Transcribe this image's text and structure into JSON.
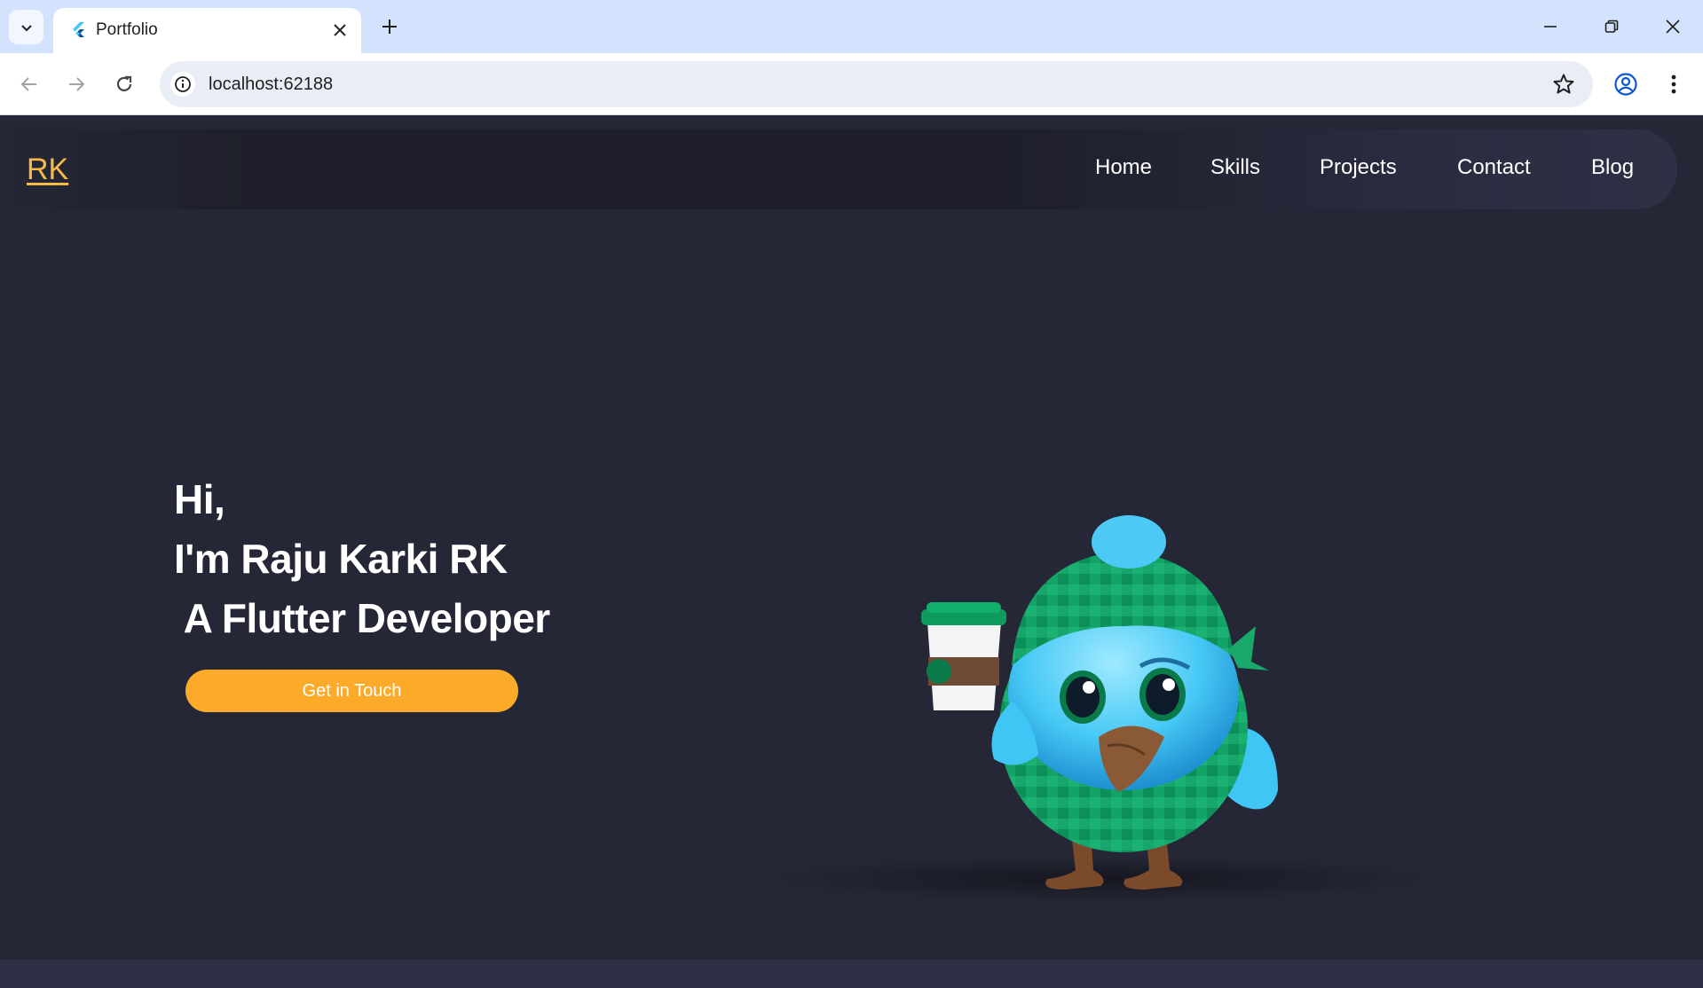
{
  "browser": {
    "tab": {
      "title": "Portfolio"
    },
    "address": {
      "url": "localhost:62188"
    }
  },
  "site": {
    "logo": "RK",
    "nav": [
      {
        "label": "Home"
      },
      {
        "label": "Skills"
      },
      {
        "label": "Projects"
      },
      {
        "label": "Contact"
      },
      {
        "label": "Blog"
      }
    ],
    "hero": {
      "line1": "Hi,",
      "line2": "I'm Raju Karki RK",
      "line3": " A Flutter Developer",
      "cta": "Get in Touch"
    }
  },
  "colors": {
    "accent": "#fbab29",
    "logo": "#f7b948",
    "background": "#252736",
    "tabstrip": "#d3e3fd"
  },
  "icons": {
    "tab_search": "chevron-down-icon",
    "favicon": "flutter-icon",
    "tab_close": "close-icon",
    "new_tab": "plus-icon",
    "back": "arrow-left-icon",
    "forward": "arrow-right-icon",
    "reload": "reload-icon",
    "site_info": "info-icon",
    "bookmark": "star-icon",
    "profile": "profile-icon",
    "menu": "kebab-menu-icon",
    "minimize": "minimize-icon",
    "restore": "restore-icon",
    "close_window": "close-icon"
  }
}
